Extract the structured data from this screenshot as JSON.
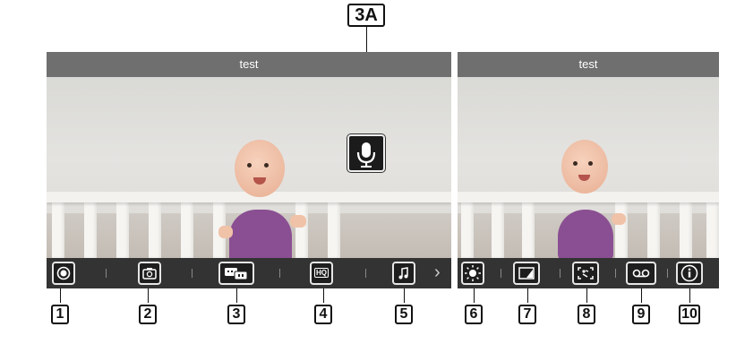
{
  "left_screen": {
    "title": "test"
  },
  "right_screen": {
    "title": "test"
  },
  "left_toolbar": {
    "buttons": [
      {
        "icon": "record-icon",
        "hq_label": ""
      },
      {
        "icon": "camera-icon"
      },
      {
        "icon": "talk-icon"
      },
      {
        "icon": "hq-icon",
        "label": "HQ"
      },
      {
        "icon": "music-note-icon"
      }
    ]
  },
  "right_toolbar": {
    "buttons": [
      {
        "icon": "brightness-icon"
      },
      {
        "icon": "zoom-icon"
      },
      {
        "icon": "pan-tilt-icon"
      },
      {
        "icon": "voicemail-icon"
      },
      {
        "icon": "info-icon"
      }
    ]
  },
  "callouts": [
    "1",
    "2",
    "3",
    "4",
    "5",
    "6",
    "7",
    "8",
    "9",
    "10"
  ],
  "callout_3a": "3A",
  "colors": {
    "titlebar": "#6f6f6f",
    "toolbar": "#333333",
    "button_bg": "#1e1e1e",
    "button_border": "#e6e6e6"
  }
}
